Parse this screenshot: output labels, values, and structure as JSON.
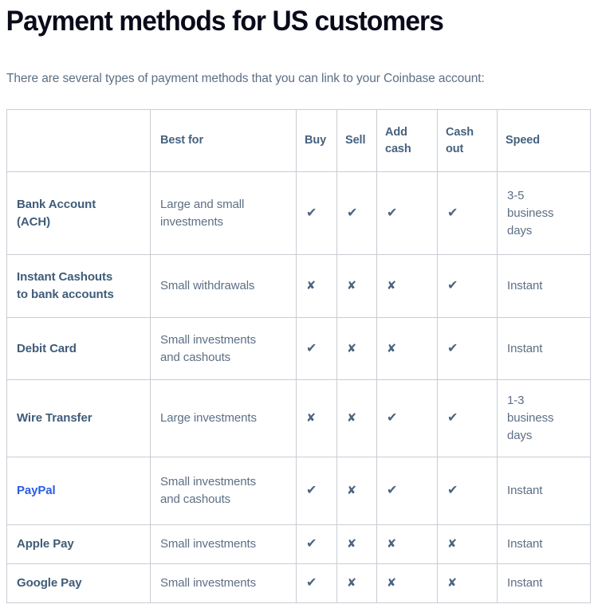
{
  "page": {
    "title": "Payment methods for US customers",
    "intro": "There are several types of payment methods that you can link to your Coinbase account:"
  },
  "colors": {
    "title": "#0a0b1a",
    "body_text": "#5d6f84",
    "header_text": "#46627f",
    "row_label": "#3f5c79",
    "link": "#2b5ce6",
    "glyph": "#4a6480",
    "border": "#c9ccd4",
    "background": "#ffffff"
  },
  "table": {
    "headers": {
      "blank": "",
      "best_for": "Best for",
      "buy": "Buy",
      "sell": "Sell",
      "add_cash_line1": "Add",
      "add_cash_line2": "cash",
      "cash_out_line1": "Cash",
      "cash_out_line2": "out",
      "speed": "Speed"
    },
    "glyphs": {
      "yes": "✔",
      "no": "✘"
    },
    "rows": [
      {
        "name_line1": "Bank Account",
        "name_line2": "(ACH)",
        "is_link": false,
        "best_for_line1": "Large and small",
        "best_for_line2": "investments",
        "buy": "✔",
        "sell": "✔",
        "add_cash": "✔",
        "cash_out": "✔",
        "speed_line1": "3-5",
        "speed_line2": "business",
        "speed_line3": "days"
      },
      {
        "name_line1": "Instant Cashouts",
        "name_line2": "to bank accounts",
        "is_link": false,
        "best_for_line1": "Small withdrawals",
        "best_for_line2": "",
        "buy": "✘",
        "sell": "✘",
        "add_cash": "✘",
        "cash_out": "✔",
        "speed_line1": "Instant",
        "speed_line2": "",
        "speed_line3": ""
      },
      {
        "name_line1": "Debit Card",
        "name_line2": "",
        "is_link": false,
        "best_for_line1": "Small investments",
        "best_for_line2": "and cashouts",
        "buy": "✔",
        "sell": "✘",
        "add_cash": "✘",
        "cash_out": "✔",
        "speed_line1": "Instant",
        "speed_line2": "",
        "speed_line3": ""
      },
      {
        "name_line1": "Wire Transfer",
        "name_line2": "",
        "is_link": false,
        "best_for_line1": "Large investments",
        "best_for_line2": "",
        "buy": "✘",
        "sell": "✘",
        "add_cash": "✔",
        "cash_out": "✔",
        "speed_line1": "1-3",
        "speed_line2": "business",
        "speed_line3": "days"
      },
      {
        "name_line1": "PayPal",
        "name_line2": "",
        "is_link": true,
        "best_for_line1": "Small investments",
        "best_for_line2": "and cashouts",
        "buy": "✔",
        "sell": "✘",
        "add_cash": "✔",
        "cash_out": "✔",
        "speed_line1": "Instant",
        "speed_line2": "",
        "speed_line3": ""
      },
      {
        "name_line1": "Apple Pay",
        "name_line2": "",
        "is_link": false,
        "best_for_line1": "Small investments",
        "best_for_line2": "",
        "buy": "✔",
        "sell": "✘",
        "add_cash": "✘",
        "cash_out": "✘",
        "speed_line1": "Instant",
        "speed_line2": "",
        "speed_line3": ""
      },
      {
        "name_line1": "Google Pay",
        "name_line2": "",
        "is_link": false,
        "best_for_line1": "Small investments",
        "best_for_line2": "",
        "buy": "✔",
        "sell": "✘",
        "add_cash": "✘",
        "cash_out": "✘",
        "speed_line1": "Instant",
        "speed_line2": "",
        "speed_line3": ""
      }
    ]
  }
}
